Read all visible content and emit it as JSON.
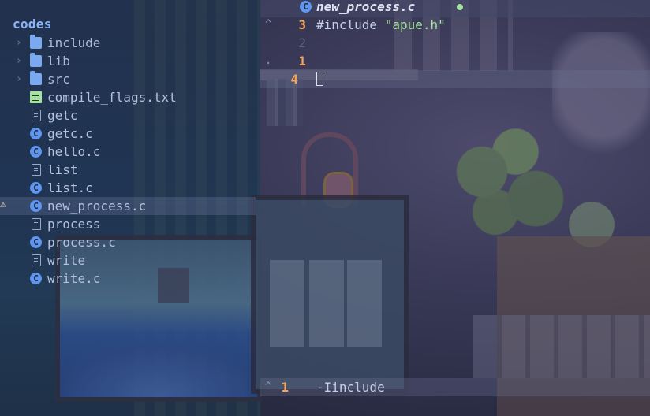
{
  "explorer": {
    "root": "codes",
    "items": [
      {
        "name": "include",
        "kind": "folder",
        "icon": "folder-icon"
      },
      {
        "name": "lib",
        "kind": "folder",
        "icon": "folder-icon"
      },
      {
        "name": "src",
        "kind": "folder",
        "icon": "folder-icon"
      },
      {
        "name": "compile_flags.txt",
        "kind": "text",
        "icon": "text-file-icon"
      },
      {
        "name": "getc",
        "kind": "file",
        "icon": "file-icon"
      },
      {
        "name": "getc.c",
        "kind": "c",
        "icon": "c-file-icon"
      },
      {
        "name": "hello.c",
        "kind": "c",
        "icon": "c-file-icon"
      },
      {
        "name": "list",
        "kind": "file",
        "icon": "file-icon"
      },
      {
        "name": "list.c",
        "kind": "c",
        "icon": "c-file-icon"
      },
      {
        "name": "new_process.c",
        "kind": "c",
        "icon": "c-file-icon",
        "selected": true,
        "warning": true
      },
      {
        "name": "process",
        "kind": "file",
        "icon": "file-icon"
      },
      {
        "name": "process.c",
        "kind": "c",
        "icon": "c-file-icon"
      },
      {
        "name": "write",
        "kind": "file",
        "icon": "file-icon"
      },
      {
        "name": "write.c",
        "kind": "c",
        "icon": "c-file-icon"
      }
    ],
    "warning_icon": "⚠"
  },
  "editor": {
    "tab_title": "new_process.c",
    "tab_icon": "C",
    "lines": [
      {
        "marker": "^",
        "num": "3",
        "code_pre": "#include ",
        "code_str": "\"apue.h\""
      },
      {
        "marker": "",
        "num": "2",
        "code_pre": "",
        "code_str": ""
      },
      {
        "marker": ".",
        "num": "1",
        "code_pre": "",
        "code_str": ""
      },
      {
        "marker": "",
        "num": "4",
        "code_pre": "",
        "code_str": ""
      }
    ]
  },
  "bottom": {
    "marker": "^",
    "num": "1",
    "text": "-Iinclude"
  },
  "colors": {
    "accent": "#89b4fa",
    "line_number": "#f2a35e",
    "string": "#a6e3a1",
    "modified_dot": "#a6e3a1",
    "warning": "#f9e2af"
  }
}
